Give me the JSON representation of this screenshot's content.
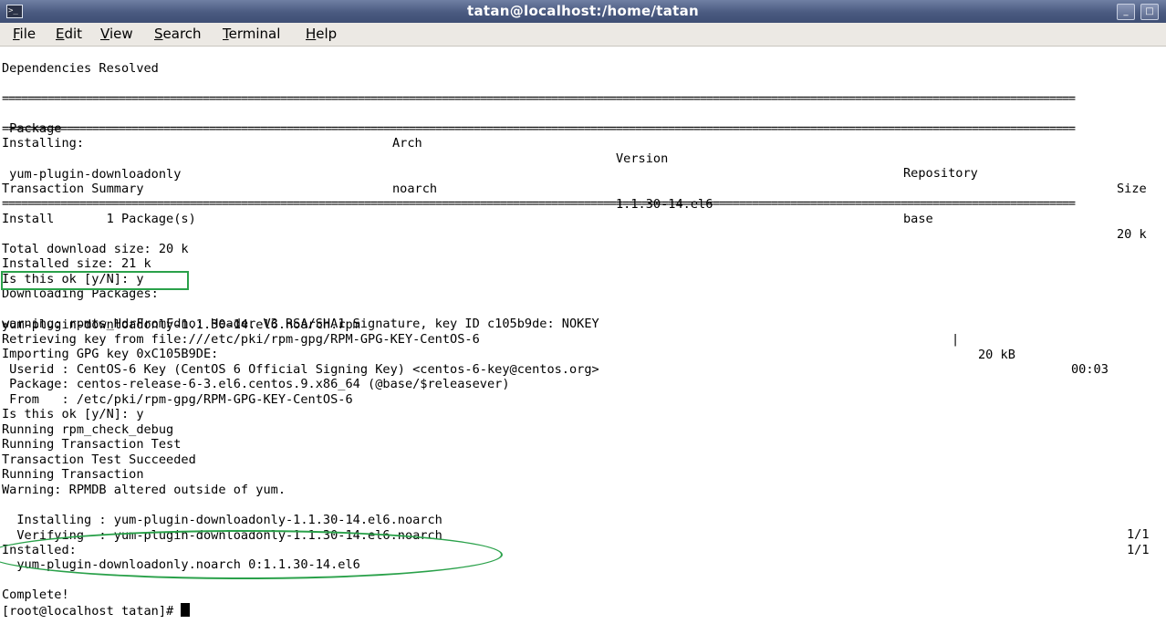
{
  "window": {
    "title": "tatan@localhost:/home/tatan",
    "minimize_glyph": "_",
    "maximize_glyph": "□"
  },
  "menu": [
    {
      "label": "File",
      "key": "F",
      "rest": "ile"
    },
    {
      "label": "Edit",
      "key": "E",
      "rest": "dit"
    },
    {
      "label": "View",
      "key": "V",
      "rest": "iew"
    },
    {
      "label": "Search",
      "key": "S",
      "rest": "earch"
    },
    {
      "label": "Terminal",
      "key": "T",
      "rest": "erminal"
    },
    {
      "label": "Help",
      "key": "H",
      "rest": "elp"
    }
  ],
  "terminal": {
    "separator": "======================================================================================================================================================================",
    "deps_resolved": "Dependencies Resolved",
    "table": {
      "headers": {
        "package": " Package",
        "arch": "Arch",
        "version": "Version",
        "repository": "Repository",
        "size": "Size"
      },
      "section": "Installing:",
      "row": {
        "package": " yum-plugin-downloadonly",
        "arch": "noarch",
        "version": "1.1.30-14.el6",
        "repository": "base",
        "size": "20 k"
      }
    },
    "txn_summary": "Transaction Summary",
    "install_line": "Install       1 Package(s)",
    "total_download": "Total download size: 20 k",
    "installed_size": "Installed size: 21 k",
    "is_ok_1": "Is this ok [y/N]: y",
    "downloading": "Downloading Packages:",
    "download_file": "yum-plugin-downloadonly-1.1.30-14.el6.noarch.rpm",
    "download_bar": "|",
    "download_size": "20 kB",
    "download_time": "00:03",
    "warning_rpmts": "warning: rpmts_HdrFromFdno: Header V3 RSA/SHA1 Signature, key ID c105b9de: NOKEY",
    "retrieving": "Retrieving key from file:///etc/pki/rpm-gpg/RPM-GPG-KEY-CentOS-6",
    "importing": "Importing GPG key 0xC105B9DE:",
    "userid": " Userid : CentOS-6 Key (CentOS 6 Official Signing Key) <centos-6-key@centos.org>",
    "package": " Package: centos-release-6-3.el6.centos.9.x86_64 (@base/$releasever)",
    "from": " From   : /etc/pki/rpm-gpg/RPM-GPG-KEY-CentOS-6",
    "is_ok_2": "Is this ok [y/N]: y",
    "check_debug": "Running rpm_check_debug",
    "txn_test": "Running Transaction Test",
    "txn_test_ok": "Transaction Test Succeeded",
    "running_txn": "Running Transaction",
    "warning_rpmdb": "Warning: RPMDB altered outside of yum.",
    "installing_step": "  Installing : yum-plugin-downloadonly-1.1.30-14.el6.noarch",
    "installing_count": "1/1",
    "verifying_step": "  Verifying  : yum-plugin-downloadonly-1.1.30-14.el6.noarch",
    "verifying_count": "1/1",
    "installed_hdr": "Installed:",
    "installed_pkg": "  yum-plugin-downloadonly.noarch 0:1.1.30-14.el6",
    "complete": "Complete!",
    "prompt": "[root@localhost tatan]# "
  },
  "colors": {
    "highlight": "#2aa14a",
    "titlebar": "#4a5a80"
  }
}
